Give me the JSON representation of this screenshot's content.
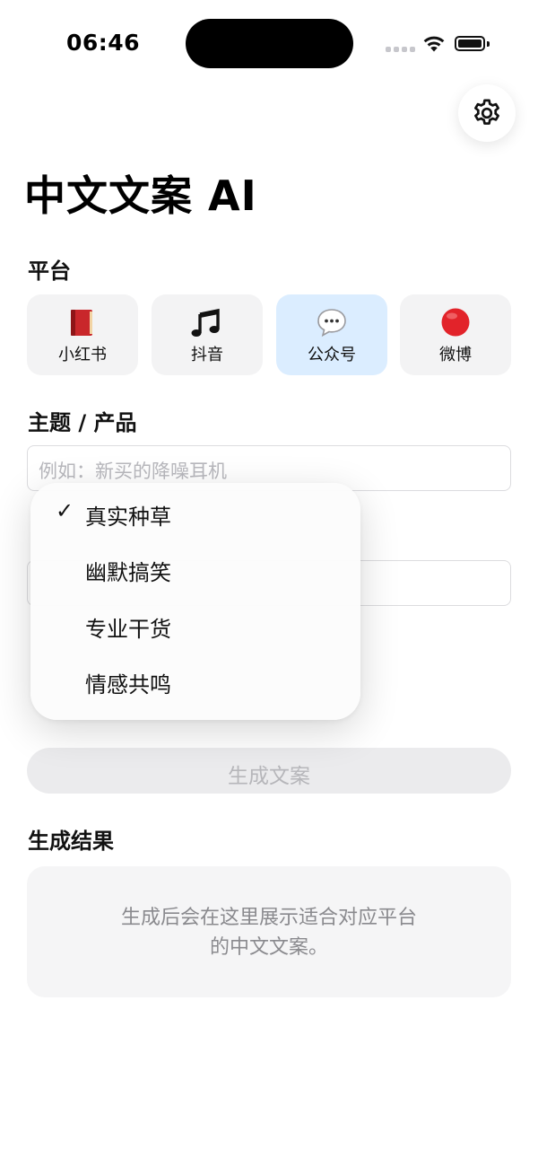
{
  "status_bar": {
    "time": "06:46"
  },
  "app": {
    "title": "中文文案 AI"
  },
  "platform_section": {
    "label": "平台",
    "items": [
      {
        "name": "小红书",
        "icon": "red-book-icon",
        "selected": false
      },
      {
        "name": "抖音",
        "icon": "music-note-icon",
        "selected": false
      },
      {
        "name": "公众号",
        "icon": "speech-bubble-icon",
        "selected": true
      },
      {
        "name": "微博",
        "icon": "red-circle-icon",
        "selected": false
      }
    ]
  },
  "topic_section": {
    "label": "主题 / 产品",
    "placeholder": "例如：新买的降噪耳机"
  },
  "style_menu": {
    "items": [
      {
        "label": "真实种草",
        "checked": true
      },
      {
        "label": "幽默搞笑",
        "checked": false
      },
      {
        "label": "专业干货",
        "checked": false
      },
      {
        "label": "情感共鸣",
        "checked": false
      }
    ],
    "check_mark": "✓"
  },
  "generate_button": {
    "label": "生成文案",
    "enabled": false
  },
  "result_section": {
    "label": "生成结果",
    "placeholder": "生成后会在这里展示适合对应平台的中文文案。"
  },
  "colors": {
    "selected_platform_bg": "#dbedff",
    "card_bg": "#f3f3f4",
    "disabled_button_bg": "#ebebed"
  }
}
